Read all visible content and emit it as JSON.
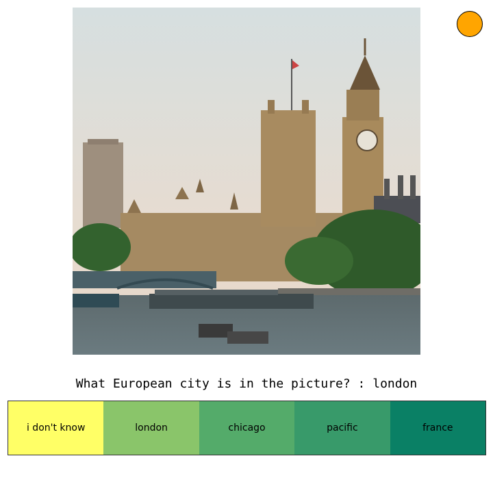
{
  "photo": {
    "subject": "Palace of Westminster and Big Ben beside the River Thames"
  },
  "indicator": {
    "color": "#ffa500"
  },
  "question": {
    "text": "What European city is in the picture? : london"
  },
  "options": [
    {
      "label": "i don't know",
      "color": "#ffff66"
    },
    {
      "label": "london",
      "color": "#8ac56a"
    },
    {
      "label": "chicago",
      "color": "#54ab6a"
    },
    {
      "label": "pacific",
      "color": "#389a6a"
    },
    {
      "label": "france",
      "color": "#0a8065"
    }
  ]
}
